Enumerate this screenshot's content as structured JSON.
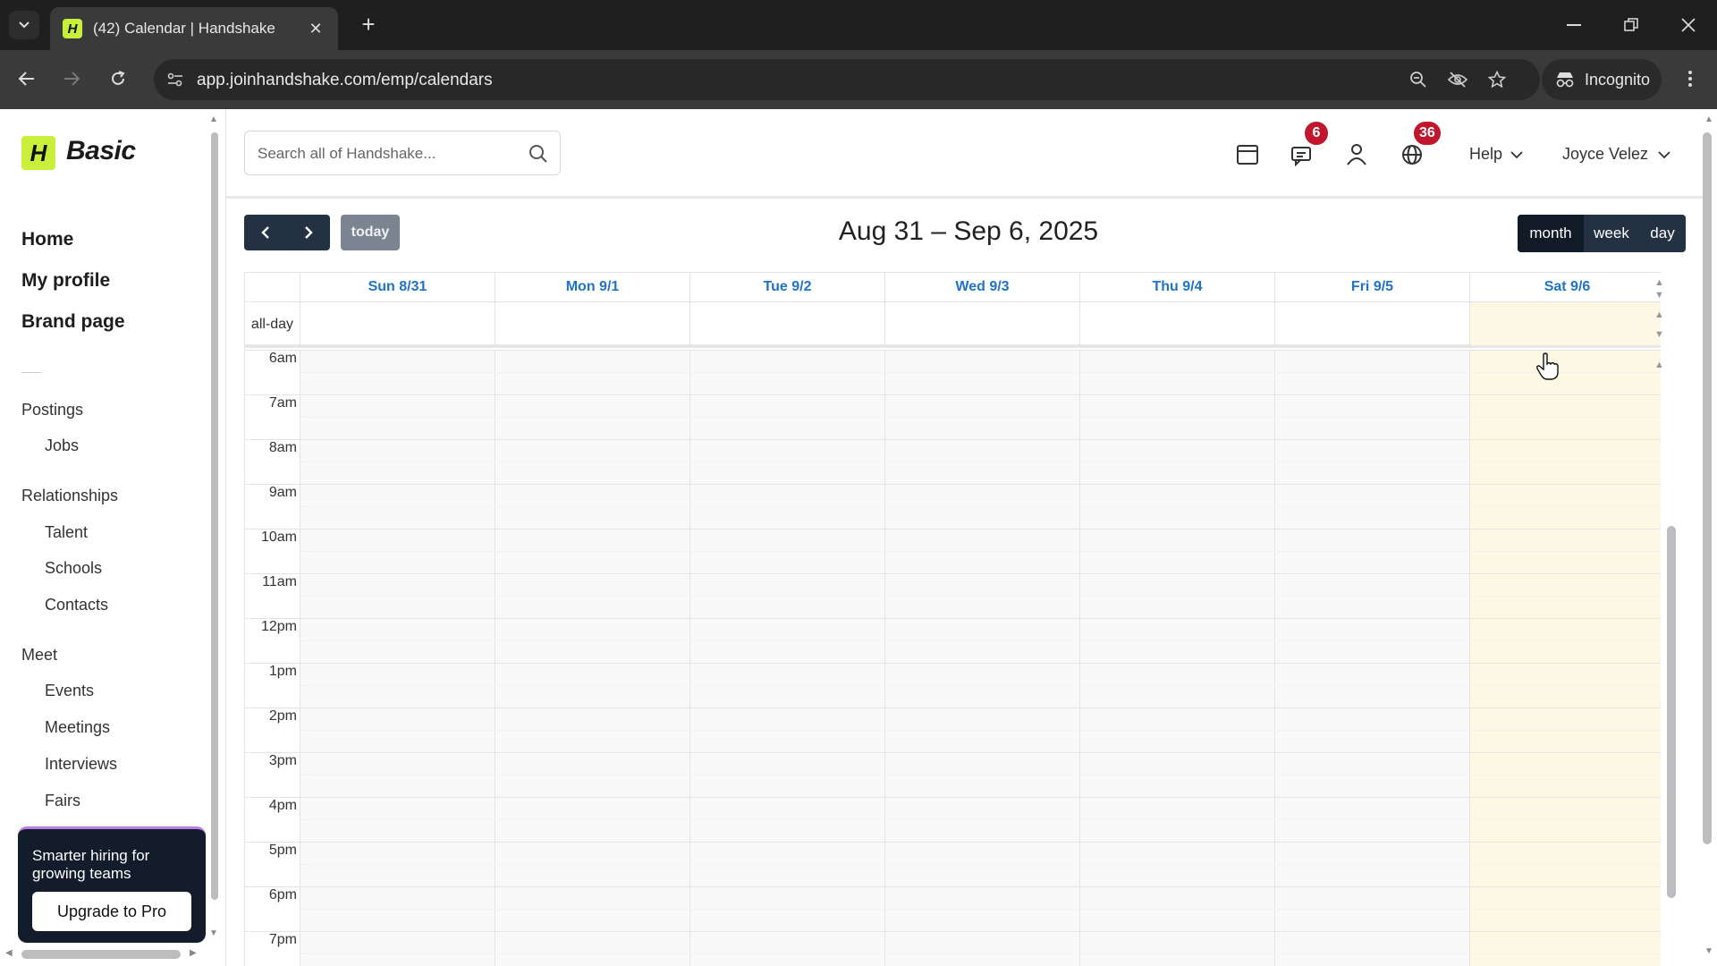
{
  "browser": {
    "tab_title": "(42) Calendar | Handshake",
    "favicon_letter": "H",
    "url": "app.joinhandshake.com/emp/calendars",
    "incognito_label": "Incognito"
  },
  "sidebar": {
    "logo_letter": "H",
    "plan_label": "Basic",
    "main_links": [
      {
        "label": "Home"
      },
      {
        "label": "My profile"
      },
      {
        "label": "Brand page"
      }
    ],
    "groups": [
      {
        "label": "Postings",
        "items": [
          "Jobs"
        ]
      },
      {
        "label": "Relationships",
        "items": [
          "Talent",
          "Schools",
          "Contacts"
        ]
      },
      {
        "label": "Meet",
        "items": [
          "Events",
          "Meetings",
          "Interviews",
          "Fairs"
        ]
      }
    ],
    "promo": {
      "text": "Smarter hiring for growing teams",
      "button_label": "Upgrade to Pro"
    }
  },
  "header": {
    "search_placeholder": "Search all of Handshake...",
    "messages_badge": "6",
    "notifications_badge": "36",
    "help_label": "Help",
    "user_name": "Joyce Velez"
  },
  "calendar": {
    "today_label": "today",
    "title": "Aug 31 – Sep 6, 2025",
    "views": [
      "month",
      "week",
      "day"
    ],
    "active_view": "month",
    "days": [
      "Sun 8/31",
      "Mon 9/1",
      "Tue 9/2",
      "Wed 9/3",
      "Thu 9/4",
      "Fri 9/5",
      "Sat 9/6"
    ],
    "today_index": 6,
    "allday_label": "all-day",
    "hours": [
      "6am",
      "7am",
      "8am",
      "9am",
      "10am",
      "11am",
      "12pm",
      "1pm",
      "2pm",
      "3pm",
      "4pm",
      "5pm",
      "6pm",
      "7pm"
    ],
    "colors": {
      "day_header": "#1f73c9",
      "today_highlight": "#fcf8e3",
      "nav_button": "#233142"
    }
  }
}
